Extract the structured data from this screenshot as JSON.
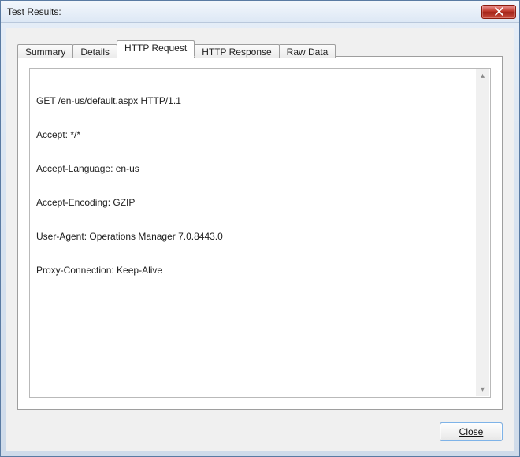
{
  "window": {
    "title": "Test Results:"
  },
  "tabs": {
    "summary": "Summary",
    "details": "Details",
    "http_request": "HTTP Request",
    "http_response": "HTTP Response",
    "raw_data": "Raw Data",
    "active": "http_request"
  },
  "http_request": {
    "lines": [
      "GET /en-us/default.aspx HTTP/1.1",
      "Accept: */*",
      "Accept-Language: en-us",
      "Accept-Encoding: GZIP",
      "User-Agent: Operations Manager 7.0.8443.0",
      "Proxy-Connection: Keep-Alive"
    ]
  },
  "buttons": {
    "close": "Close"
  },
  "glyphs": {
    "scroll_up": "▴",
    "scroll_down": "▾"
  }
}
